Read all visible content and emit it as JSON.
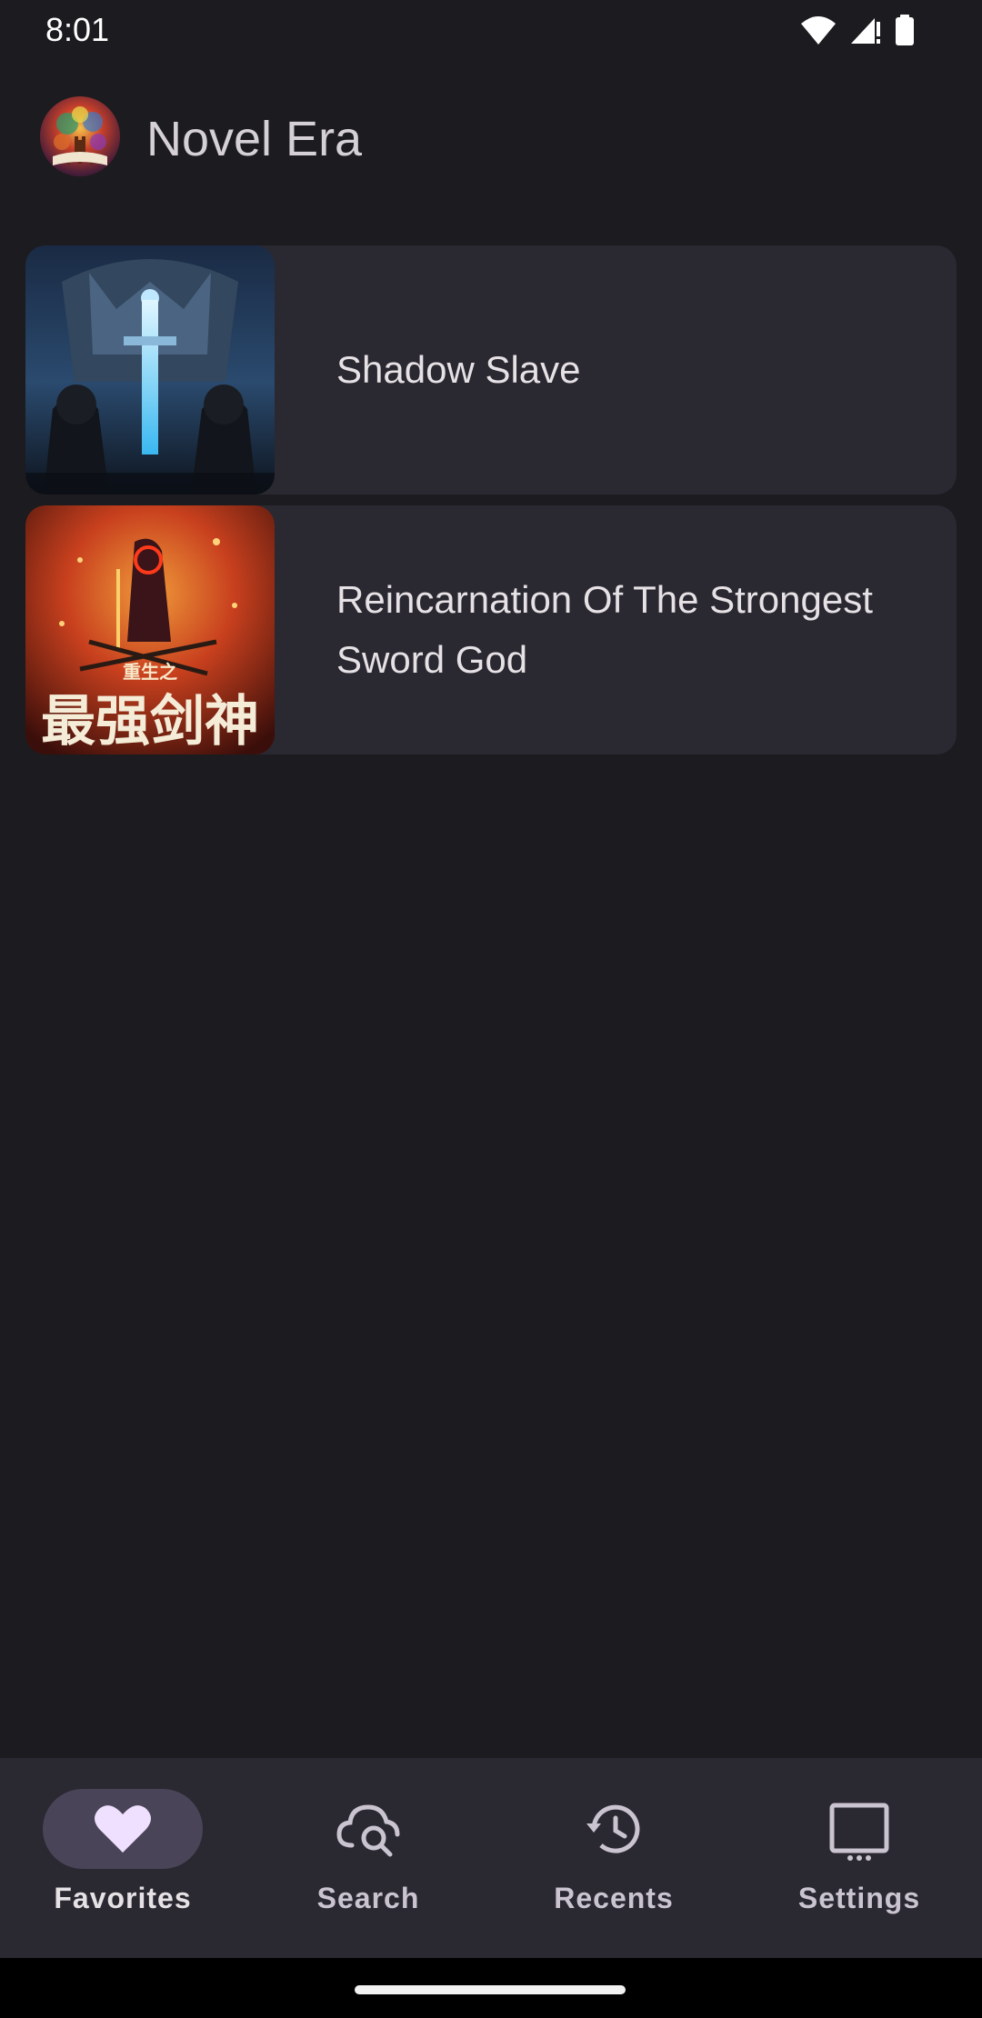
{
  "status_bar": {
    "time": "8:01",
    "icons": [
      "wifi-icon",
      "cellular-signal-icon",
      "battery-icon"
    ]
  },
  "app_bar": {
    "title": "Novel Era",
    "logo_icon": "tree-logo-icon"
  },
  "novels": [
    {
      "title": "Shadow Slave"
    },
    {
      "title": "Reincarnation Of The Strongest Sword God",
      "cover_text_small": "重生之",
      "cover_text_large": "最强剑神"
    }
  ],
  "bottom_nav": {
    "items": [
      {
        "label": "Favorites",
        "icon": "heart-icon",
        "active": true
      },
      {
        "label": "Search",
        "icon": "cloud-search-icon",
        "active": false
      },
      {
        "label": "Recents",
        "icon": "history-icon",
        "active": false
      },
      {
        "label": "Settings",
        "icon": "settings-screen-icon",
        "active": false
      }
    ]
  },
  "colors": {
    "background": "#1c1b1f",
    "card": "#2a2830",
    "nav_active_pill": "#4a4458",
    "active_icon": "#f0e0ff"
  }
}
